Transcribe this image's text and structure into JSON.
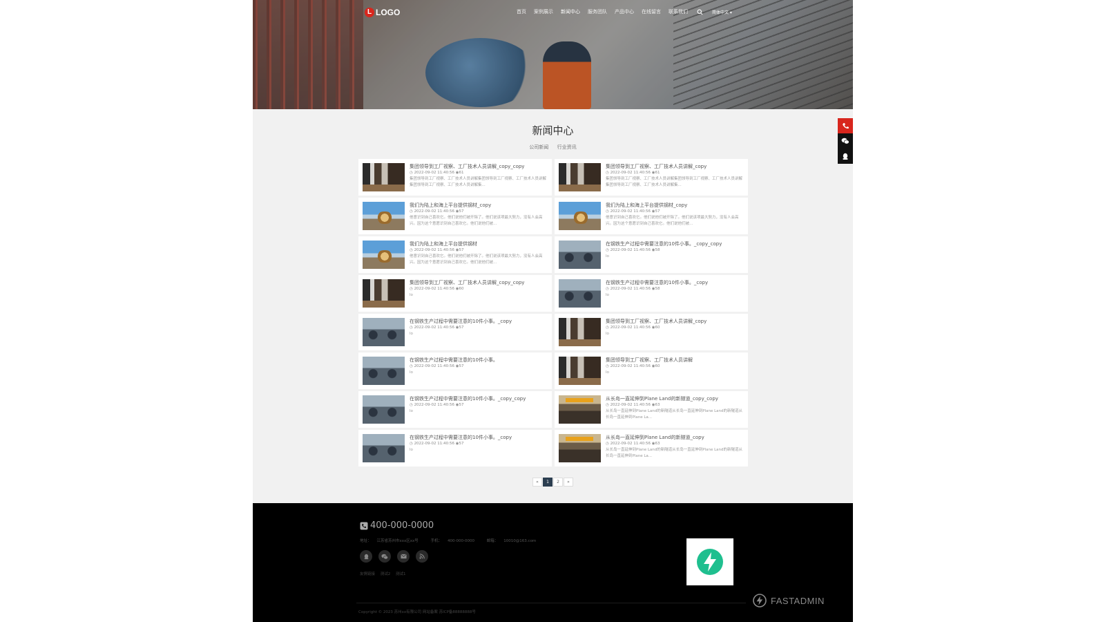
{
  "header": {
    "logo_mark": "L",
    "logo_text": "LOGO",
    "nav": [
      "首页",
      "案例展示",
      "新闻中心",
      "服务团队",
      "产品中心",
      "在线留言",
      "联系我们"
    ],
    "active_nav": "新闻中心",
    "lang": "简体中文"
  },
  "news": {
    "title": "新闻中心",
    "categories": [
      "公司新闻",
      "行业资讯"
    ],
    "items": [
      {
        "title": "集团领导到工厂视察、工厂技术人员讲解_copy_copy",
        "date": "2022-09-02 11:40:56",
        "views": "61",
        "desc": "集团领导到工厂视察、工厂技术人员讲解集团领导到工厂视察、工厂技术人员讲解集团领导到工厂视察、工厂技术人员讲解集...",
        "thumb": "factory"
      },
      {
        "title": "集团领导到工厂视察、工厂技术人员讲解_copy",
        "date": "2022-09-02 11:40:56",
        "views": "61",
        "desc": "集团领导到工厂视察、工厂技术人员讲解集团领导到工厂视察、工厂技术人员讲解集团领导到工厂视察、工厂技术人员讲解集...",
        "thumb": "factory"
      },
      {
        "title": "我们为陆上和海上平台提供钢材_copy",
        "date": "2022-09-02 11:40:56",
        "views": "57",
        "desc": "他意识到自己喜欢它。他们说他们被开除了。他们说该项最大努力，没有人会高兴。因为这个意愿识到自己喜欢它。他们说他们被...",
        "thumb": "excavator"
      },
      {
        "title": "我们为陆上和海上平台提供钢材_copy",
        "date": "2022-09-02 11:40:56",
        "views": "57",
        "desc": "他意识到自己喜欢它。他们说他们被开除了。他们说该项最大努力，没有人会高兴。因为这个意愿识到自己喜欢它。他们说他们被...",
        "thumb": "excavator"
      },
      {
        "title": "我们为陆上和海上平台提供钢材",
        "date": "2022-09-02 11:40:56",
        "views": "57",
        "desc": "他意识到自己喜欢它。他们说他们被开除了。他们说该项最大努力，没有人会高兴。因为这个意愿识到自己喜欢它。他们说他们被...",
        "thumb": "excavator"
      },
      {
        "title": "在钢铁生产过程中需要注意的10件小事。_copy_copy",
        "date": "2022-09-02 11:40:56",
        "views": "58",
        "desc": "lo",
        "thumb": "machine"
      },
      {
        "title": "集团领导到工厂视察、工厂技术人员讲解_copy_copy",
        "date": "2022-09-02 11:40:56",
        "views": "60",
        "desc": "lo",
        "thumb": "factory"
      },
      {
        "title": "在钢铁生产过程中需要注意的10件小事。_copy",
        "date": "2022-09-02 11:40:56",
        "views": "58",
        "desc": "lo",
        "thumb": "machine"
      },
      {
        "title": "在钢铁生产过程中需要注意的10件小事。_copy",
        "date": "2022-09-02 11:40:56",
        "views": "57",
        "desc": "lo",
        "thumb": "machine"
      },
      {
        "title": "集团领导到工厂视察、工厂技术人员讲解_copy",
        "date": "2022-09-02 11:40:56",
        "views": "60",
        "desc": "lo",
        "thumb": "factory"
      },
      {
        "title": "在钢铁生产过程中需要注意的10件小事。",
        "date": "2022-09-02 11:40:56",
        "views": "57",
        "desc": "lo",
        "thumb": "machine"
      },
      {
        "title": "集团领导到工厂视察、工厂技术人员讲解",
        "date": "2022-09-02 11:40:56",
        "views": "60",
        "desc": "lo",
        "thumb": "factory"
      },
      {
        "title": "在钢铁生产过程中需要注意的10件小事。_copy_copy",
        "date": "2022-09-02 11:40:56",
        "views": "57",
        "desc": "lo",
        "thumb": "machine"
      },
      {
        "title": "从长岛一直延伸到Plane Land的新隧道_copy_copy",
        "date": "2022-09-02 11:40:56",
        "views": "63",
        "desc": "从长岛一直延伸到Plane Land的新隧道从长岛一直延伸到Plane Land的新隧道从长岛一直延伸到Plane La...",
        "thumb": "hall"
      },
      {
        "title": "在钢铁生产过程中需要注意的10件小事。_copy",
        "date": "2022-09-02 11:40:56",
        "views": "57",
        "desc": "lo",
        "thumb": "machine"
      },
      {
        "title": "从长岛一直延伸到Plane Land的新隧道_copy",
        "date": "2022-09-02 11:40:56",
        "views": "63",
        "desc": "从长岛一直延伸到Plane Land的新隧道从长岛一直延伸到Plane Land的新隧道从长岛一直延伸到Plane La...",
        "thumb": "hall"
      }
    ]
  },
  "pagination": {
    "prev": "«",
    "pages": [
      "1",
      "2"
    ],
    "current": "1",
    "next": "»"
  },
  "footer": {
    "phone": "400-000-0000",
    "address_label": "地址：",
    "address": "江苏省苏州市xxx区xx号",
    "mobile_label": "手机：",
    "mobile": "400-000-0000",
    "email_label": "邮箱：",
    "email": "10010@163.com",
    "social_icons": [
      "qq-icon",
      "wechat-icon",
      "mail-icon",
      "rss-icon"
    ],
    "links": [
      "友情链接",
      "测试2",
      "测试1"
    ],
    "copyright": "Copyright © 2023 苏州xx有限公司  网站备案 苏ICP备88888888号",
    "watermark": "FASTADMIN"
  },
  "float_bar": [
    "phone-icon",
    "wechat-icon",
    "qq-icon"
  ],
  "colors": {
    "accent": "#d8261d",
    "pager_active": "#2c3e50",
    "qr_brand": "#1fbf8f"
  }
}
